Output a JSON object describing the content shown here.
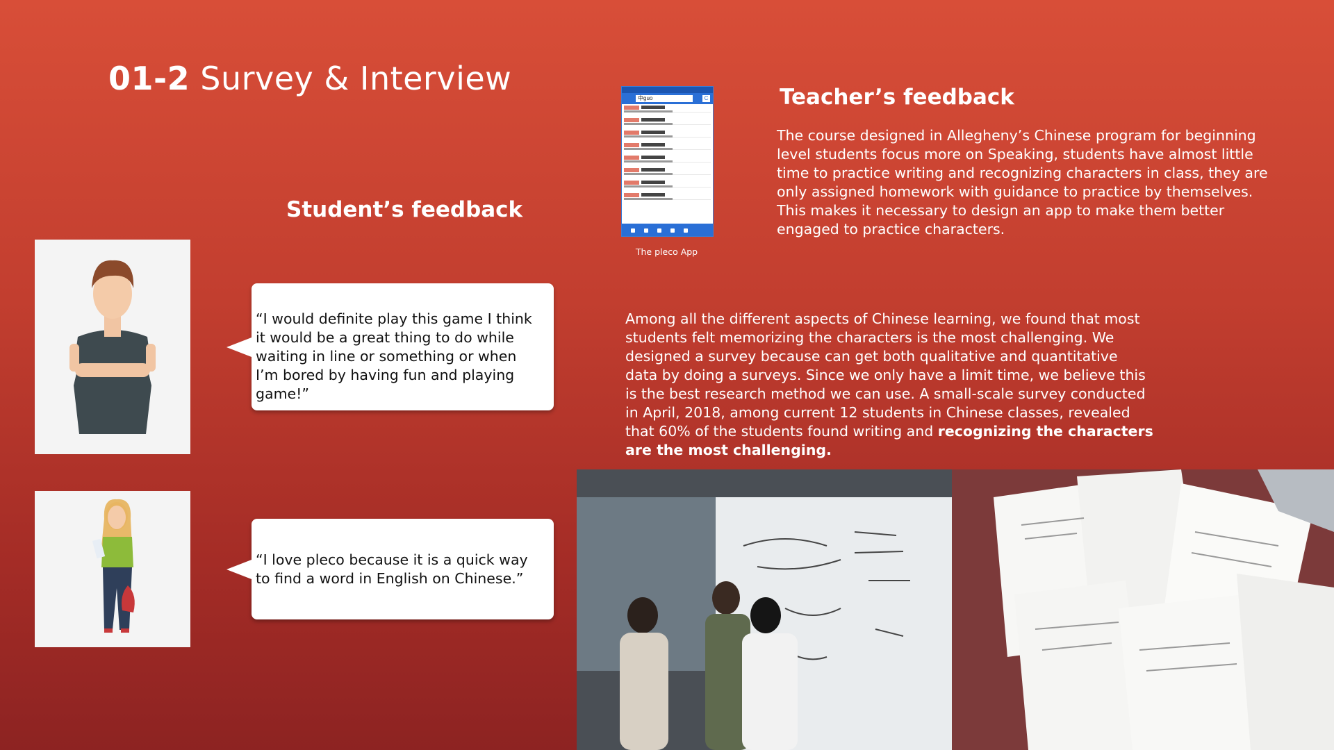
{
  "header": {
    "number": "01-2",
    "title": "Survey & Interview"
  },
  "student": {
    "heading": "Student’s feedback",
    "quotes": [
      " “I would definite play this game I think it would be a great thing to do while waiting in line or something or when I’m bored by having fun and playing game!”",
      "“I love pleco because it is a quick way to find a word in English on Chinese.”"
    ]
  },
  "teacher": {
    "heading": "Teacher’s feedback",
    "body": "The course designed in Allegheny’s Chinese program for beginning level students focus more on Speaking, students have almost little time to practice writing and recognizing characters in class, they are only assigned homework with guidance to practice by themselves. This makes it necessary to design an app to make them better engaged to practice characters."
  },
  "app": {
    "caption": "The pleco App",
    "search_text": "中guo",
    "button_label": "C"
  },
  "survey": {
    "body": "Among all the different aspects of Chinese learning, we found that most students felt memorizing the characters is the most challenging. We designed a survey because can get both qualitative and quantitative data by doing a surveys. Since we only have a limit time, we believe this is the best research method we can use. A small-scale survey conducted in April, 2018, among current 12 students in Chinese classes, revealed that 60% of the students found writing and ",
    "emphasis": "recognizing the characters are the most challenging."
  },
  "colors": {
    "background_top": "#d84e38",
    "background_bottom": "#8d2322",
    "app_blue": "#2a6fd6"
  }
}
